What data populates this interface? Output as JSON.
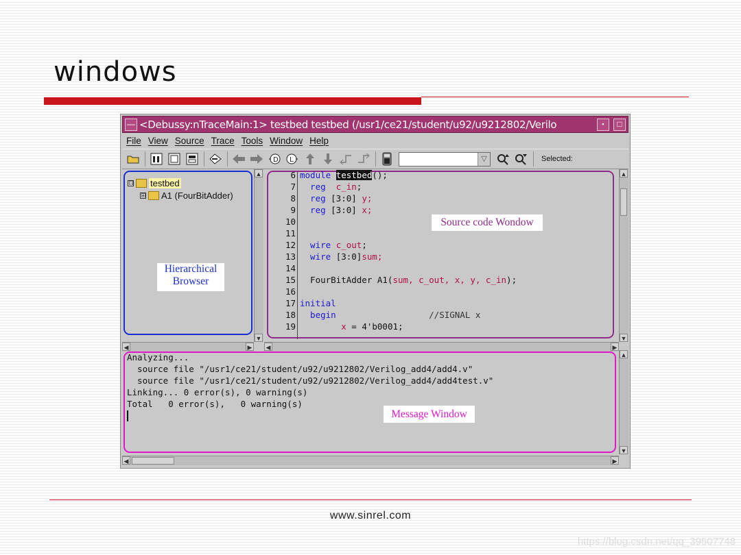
{
  "slide": {
    "title": "windows",
    "footer": "www.sinrel.com",
    "watermark": "https://blog.csdn.net/qq_39507748"
  },
  "window": {
    "title": "<Debussy:nTraceMain:1> testbed testbed (/usr1/ce21/student/u92/u9212802/Verilo",
    "menu": [
      "File",
      "View",
      "Source",
      "Trace",
      "Tools",
      "Window",
      "Help"
    ],
    "toolbar": {
      "icons": [
        "open-folder-icon",
        "hierarchy-icon",
        "signal-icon",
        "source-icon",
        "trace-icon",
        "back-arrow-icon",
        "forward-arrow-icon",
        "driver-icon",
        "load-icon",
        "up-arrow-icon",
        "down-arrow-icon",
        "step-back-icon",
        "step-forward-icon",
        "calculator-icon",
        "search-up-icon",
        "search-down-icon"
      ],
      "combo_value": "",
      "selected_label": "Selected:"
    }
  },
  "hierarchy": {
    "items": [
      {
        "label": "testbed",
        "expand": "⊟"
      },
      {
        "label": "A1 (FourBitAdder)",
        "expand": "⊞"
      }
    ],
    "callout": [
      "Hierarchical",
      "Browser"
    ]
  },
  "source": {
    "callout": "Source code Wondow",
    "lines": [
      {
        "n": "6",
        "a": "module ",
        "b": "testbed",
        "c": "();"
      },
      {
        "n": "7",
        "a": "  reg  ",
        "b": "c_in",
        "c": ";"
      },
      {
        "n": "8",
        "a": "  reg ",
        "b": "[3:0] ",
        "c": "y;"
      },
      {
        "n": "9",
        "a": "  reg ",
        "b": "[3:0] ",
        "c": "x;"
      },
      {
        "n": "10",
        "a": "",
        "b": "",
        "c": ""
      },
      {
        "n": "11",
        "a": "",
        "b": "",
        "c": ""
      },
      {
        "n": "12",
        "a": "  wire ",
        "b": "c_out",
        "c": ";"
      },
      {
        "n": "13",
        "a": "  wire ",
        "b": "[3:0]",
        "c": "sum;"
      },
      {
        "n": "14",
        "a": "",
        "b": "",
        "c": ""
      },
      {
        "n": "15",
        "a": "  FourBitAdder A1(",
        "b": "sum, c_out, x, y, c_in",
        "c": ");"
      },
      {
        "n": "16",
        "a": "",
        "b": "",
        "c": ""
      },
      {
        "n": "17",
        "a": "initial",
        "b": "",
        "c": ""
      },
      {
        "n": "18",
        "a": "  begin",
        "b": "                  //SIGNAL x",
        "c": ""
      },
      {
        "n": "19",
        "a": "        ",
        "b": "x",
        "c": " = 4'b0001;"
      }
    ]
  },
  "messages": {
    "callout": "Message Window",
    "lines": [
      "Analyzing...",
      "  source file \"/usr1/ce21/student/u92/u9212802/Verilog_add4/add4.v\"",
      "  source file \"/usr1/ce21/student/u92/u9212802/Verilog_add4/add4test.v\"",
      "Linking... 0 error(s), 0 warning(s)",
      "Total   0 error(s),   0 warning(s)"
    ]
  },
  "colors": {
    "titlebar": "#a0346e",
    "accent_red": "#c8141c",
    "hier_frame": "#1b2fd0",
    "source_frame": "#8e2a8a",
    "message_frame": "#e018c8"
  }
}
